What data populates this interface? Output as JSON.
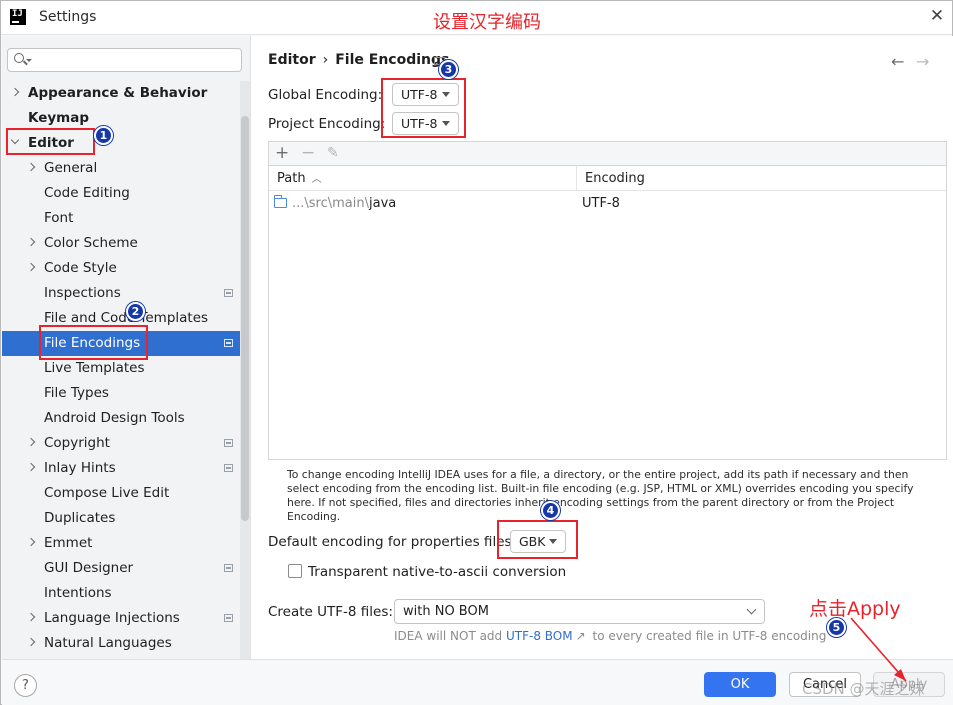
{
  "window": {
    "title": "Settings",
    "annotation_title": "设置汉字编码"
  },
  "sidebar": {
    "search_placeholder": "",
    "items": [
      {
        "label": "Appearance & Behavior",
        "indent": 0,
        "arrow": "right",
        "bold": true,
        "mark": false
      },
      {
        "label": "Keymap",
        "indent": 0,
        "arrow": "none",
        "bold": true,
        "mark": false
      },
      {
        "label": "Editor",
        "indent": 0,
        "arrow": "down",
        "bold": true,
        "mark": false
      },
      {
        "label": "General",
        "indent": 1,
        "arrow": "right",
        "bold": false,
        "mark": false
      },
      {
        "label": "Code Editing",
        "indent": 1,
        "arrow": "none",
        "bold": false,
        "mark": false
      },
      {
        "label": "Font",
        "indent": 1,
        "arrow": "none",
        "bold": false,
        "mark": false
      },
      {
        "label": "Color Scheme",
        "indent": 1,
        "arrow": "right",
        "bold": false,
        "mark": false
      },
      {
        "label": "Code Style",
        "indent": 1,
        "arrow": "right",
        "bold": false,
        "mark": false
      },
      {
        "label": "Inspections",
        "indent": 1,
        "arrow": "none",
        "bold": false,
        "mark": true
      },
      {
        "label": "File and Code Templates",
        "indent": 1,
        "arrow": "none",
        "bold": false,
        "mark": false
      },
      {
        "label": "File Encodings",
        "indent": 1,
        "arrow": "none",
        "bold": false,
        "mark": true,
        "selected": true
      },
      {
        "label": "Live Templates",
        "indent": 1,
        "arrow": "none",
        "bold": false,
        "mark": false
      },
      {
        "label": "File Types",
        "indent": 1,
        "arrow": "none",
        "bold": false,
        "mark": false
      },
      {
        "label": "Android Design Tools",
        "indent": 1,
        "arrow": "none",
        "bold": false,
        "mark": false
      },
      {
        "label": "Copyright",
        "indent": 1,
        "arrow": "right",
        "bold": false,
        "mark": true
      },
      {
        "label": "Inlay Hints",
        "indent": 1,
        "arrow": "right",
        "bold": false,
        "mark": true
      },
      {
        "label": "Compose Live Edit",
        "indent": 1,
        "arrow": "none",
        "bold": false,
        "mark": false
      },
      {
        "label": "Duplicates",
        "indent": 1,
        "arrow": "none",
        "bold": false,
        "mark": false
      },
      {
        "label": "Emmet",
        "indent": 1,
        "arrow": "right",
        "bold": false,
        "mark": false
      },
      {
        "label": "GUI Designer",
        "indent": 1,
        "arrow": "none",
        "bold": false,
        "mark": true
      },
      {
        "label": "Intentions",
        "indent": 1,
        "arrow": "none",
        "bold": false,
        "mark": false
      },
      {
        "label": "Language Injections",
        "indent": 1,
        "arrow": "right",
        "bold": false,
        "mark": true
      },
      {
        "label": "Natural Languages",
        "indent": 1,
        "arrow": "right",
        "bold": false,
        "mark": false
      }
    ]
  },
  "main": {
    "breadcrumb": {
      "parent": "Editor",
      "separator": "›",
      "current": "File Encodings"
    },
    "nav": {
      "back": "←",
      "forward": "→"
    },
    "global_encoding": {
      "label": "Global Encoding:",
      "value": "UTF-8"
    },
    "project_encoding": {
      "label": "Project Encoding:",
      "value": "UTF-8"
    },
    "toolbar": {
      "add": "+",
      "remove": "−",
      "edit": "✎"
    },
    "table": {
      "columns": [
        "Path",
        "Encoding"
      ],
      "rows": [
        {
          "path_prefix": "...\\src\\main\\",
          "path_name": "java",
          "encoding": "UTF-8"
        }
      ]
    },
    "help_text": "To change encoding IntelliJ IDEA uses for a file, a directory, or the entire project, add its path if necessary and then select encoding from the encoding list. Built-in file encoding (e.g. JSP, HTML or XML) overrides encoding you specify here. If not specified, files and directories inherit encoding settings from the parent directory or from the Project Encoding.",
    "properties_encoding": {
      "label": "Default encoding for properties files:",
      "value": "GBK"
    },
    "transparent_ascii": {
      "label": "Transparent native-to-ascii conversion",
      "checked": false
    },
    "create_utf8": {
      "label": "Create UTF-8 files:",
      "value": "with NO BOM"
    },
    "bom_hint": {
      "prefix": "IDEA will NOT add ",
      "link": "UTF-8 BOM",
      "link_icon": "↗",
      "suffix": " to every created file in UTF-8 encoding"
    }
  },
  "footer": {
    "help": "?",
    "ok": "OK",
    "cancel": "Cancel",
    "apply": "Apply",
    "watermark": "CSDN @天涯之妹"
  },
  "annotations": {
    "badges": [
      "1",
      "2",
      "3",
      "4",
      "5"
    ],
    "apply_note": "点击Apply",
    "color": "#e8232b"
  }
}
